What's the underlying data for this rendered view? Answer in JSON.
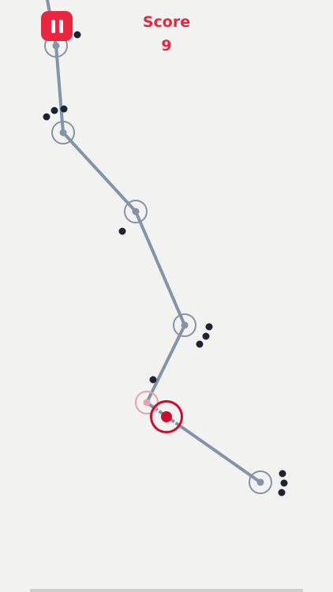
{
  "hud": {
    "score_label": "Score",
    "score_value": "9"
  },
  "colors": {
    "background": "#f2f2f0",
    "path": "#8593a6",
    "node_ring": "#8593a6",
    "ball": "#cc0d2d",
    "accent": "#e8263f",
    "obstacle": "#1e2233"
  },
  "icons": {
    "pause": "pause-icon"
  }
}
